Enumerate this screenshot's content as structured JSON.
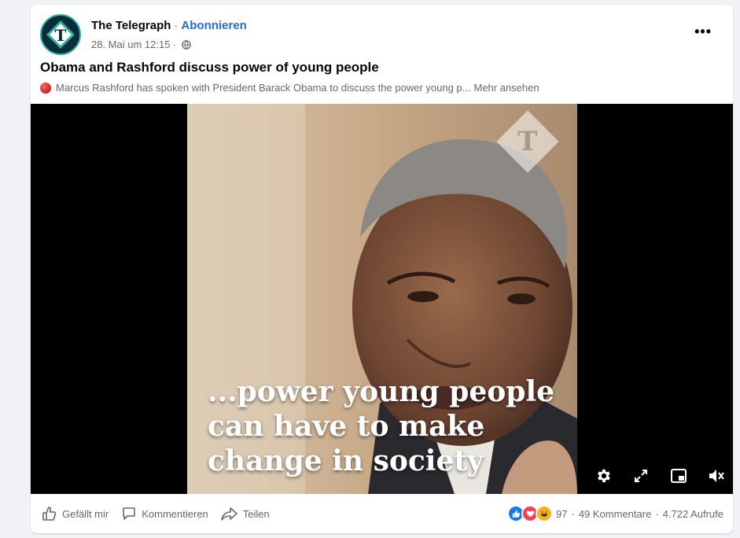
{
  "post": {
    "page_name": "The Telegraph",
    "separator": "·",
    "follow_label": "Abonnieren",
    "timestamp": "28. Mai um 12:15",
    "timestamp_sep": "·",
    "title": "Obama and Rashford discuss power of young people",
    "description": "Marcus Rashford has spoken with President Barack Obama to discuss the power young p...",
    "see_more": "Mehr ansehen"
  },
  "video": {
    "watermark": "T",
    "subtitle_lines": [
      "...power young people",
      "can have to make",
      "change in society"
    ]
  },
  "actions": {
    "like": "Gefällt mir",
    "comment": "Kommentieren",
    "share": "Teilen"
  },
  "stats": {
    "reactions_count": "97",
    "comments": "49 Kommentare",
    "sep": "·",
    "views": "4.722 Aufrufe"
  },
  "icons": {
    "avatar": "telegraph-logo-icon",
    "privacy": "globe-icon",
    "more": "more-options-icon",
    "settings": "gear-icon",
    "fullscreen": "expand-icon",
    "pip": "picture-in-picture-icon",
    "mute": "muted-speaker-icon"
  },
  "colors": {
    "accent": "#216fdb",
    "like_blue": "#1877f2",
    "love_red": "#f33e58",
    "haha_yellow": "#f7b125"
  }
}
